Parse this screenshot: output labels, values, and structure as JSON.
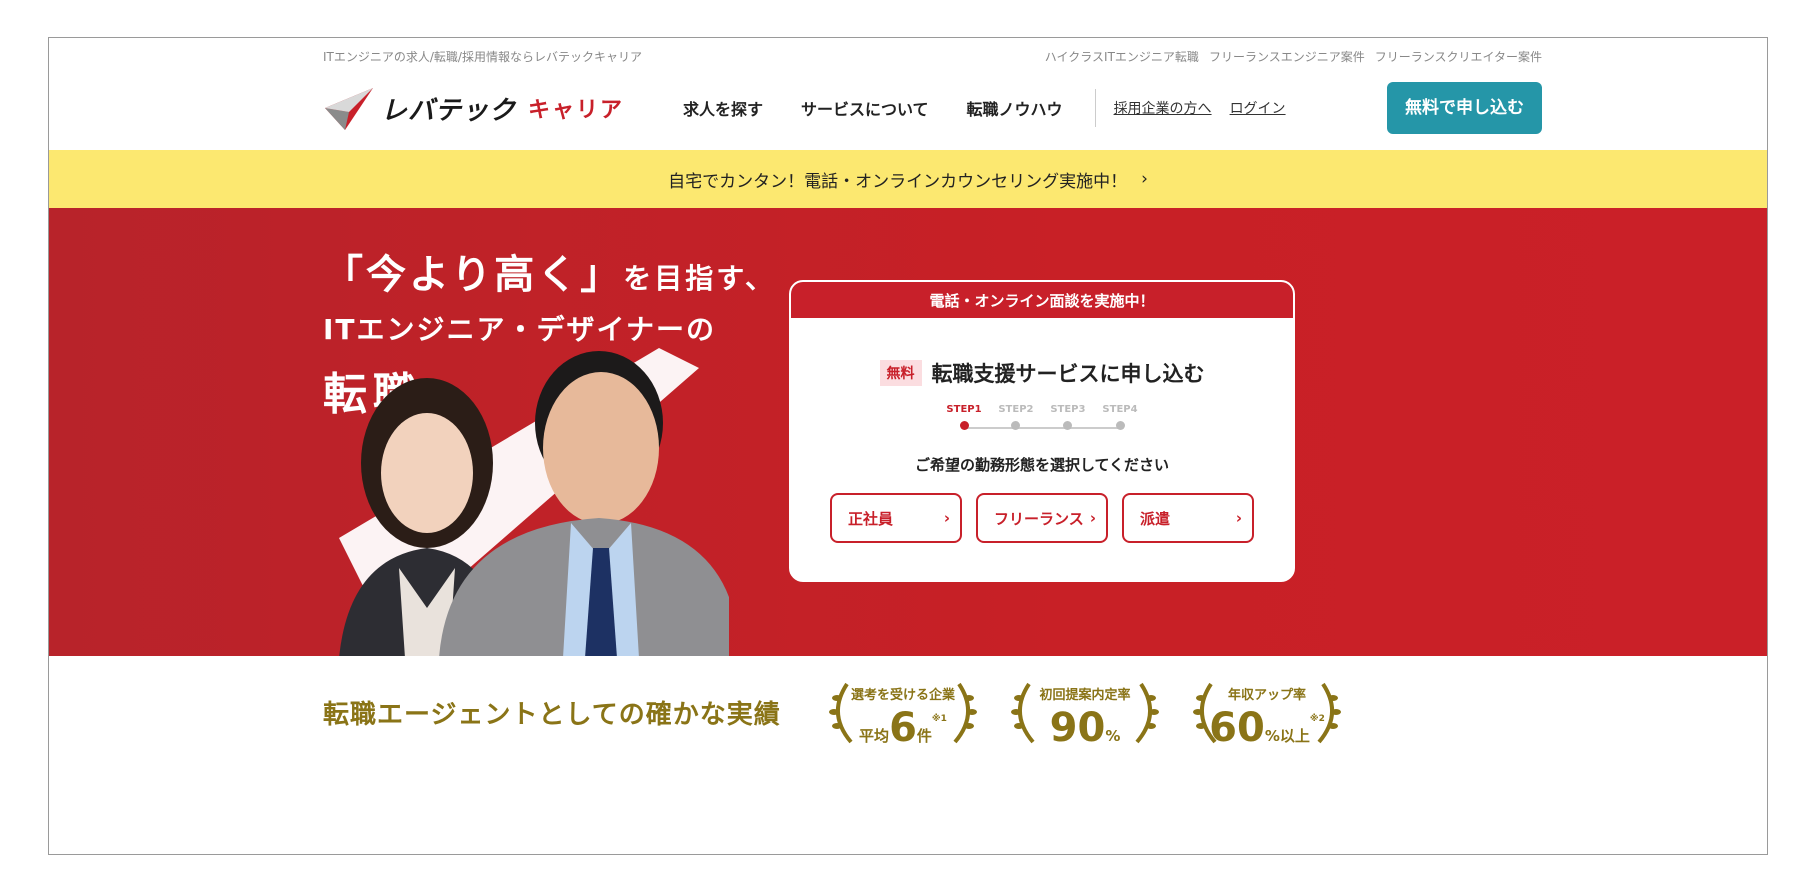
{
  "utility": {
    "tagline": "ITエンジニアの求人/転職/採用情報ならレバテックキャリア",
    "links": [
      "ハイクラスITエンジニア転職",
      "フリーランスエンジニア案件",
      "フリーランスクリエイター案件"
    ]
  },
  "header": {
    "logo_main": "レバテック",
    "logo_sub": "キャリア",
    "nav": [
      "求人を探す",
      "サービスについて",
      "転職ノウハウ"
    ],
    "sublinks": [
      "採用企業の方へ",
      "ログイン"
    ],
    "cta": "無料で申し込む"
  },
  "notice": {
    "text": "自宅でカンタン！電話・オンラインカウンセリング実施中！",
    "arrow": "›"
  },
  "hero": {
    "line1a": "「今より高く」",
    "line1b": "を目指す、",
    "line2": "ITエンジニア・デザイナーの",
    "line3": "転職"
  },
  "card": {
    "header": "電話・オンライン面談を実施中！",
    "badge": "無料",
    "title": "転職支援サービスに申し込む",
    "steps": [
      "STEP1",
      "STEP2",
      "STEP3",
      "STEP4"
    ],
    "question": "ご希望の勤務形態を選択してください",
    "choices": [
      "正社員",
      "フリーランス",
      "派遣"
    ]
  },
  "results": {
    "title": "転職エージェントとしての確かな実績",
    "awards": [
      {
        "label": "選考を受ける企業",
        "prefix": "平均",
        "value": "6",
        "unit": "件",
        "note": "※1"
      },
      {
        "label": "初回提案内定率",
        "prefix": "",
        "value": "90",
        "unit": "%",
        "note": ""
      },
      {
        "label": "年収アップ率",
        "prefix": "",
        "value": "60",
        "unit": "%以上",
        "note": "※2"
      }
    ]
  },
  "colors": {
    "brand_red": "#c8202a",
    "cta_teal": "#2596a8",
    "notice_yellow": "#fce870",
    "gold": "#8a7417"
  }
}
